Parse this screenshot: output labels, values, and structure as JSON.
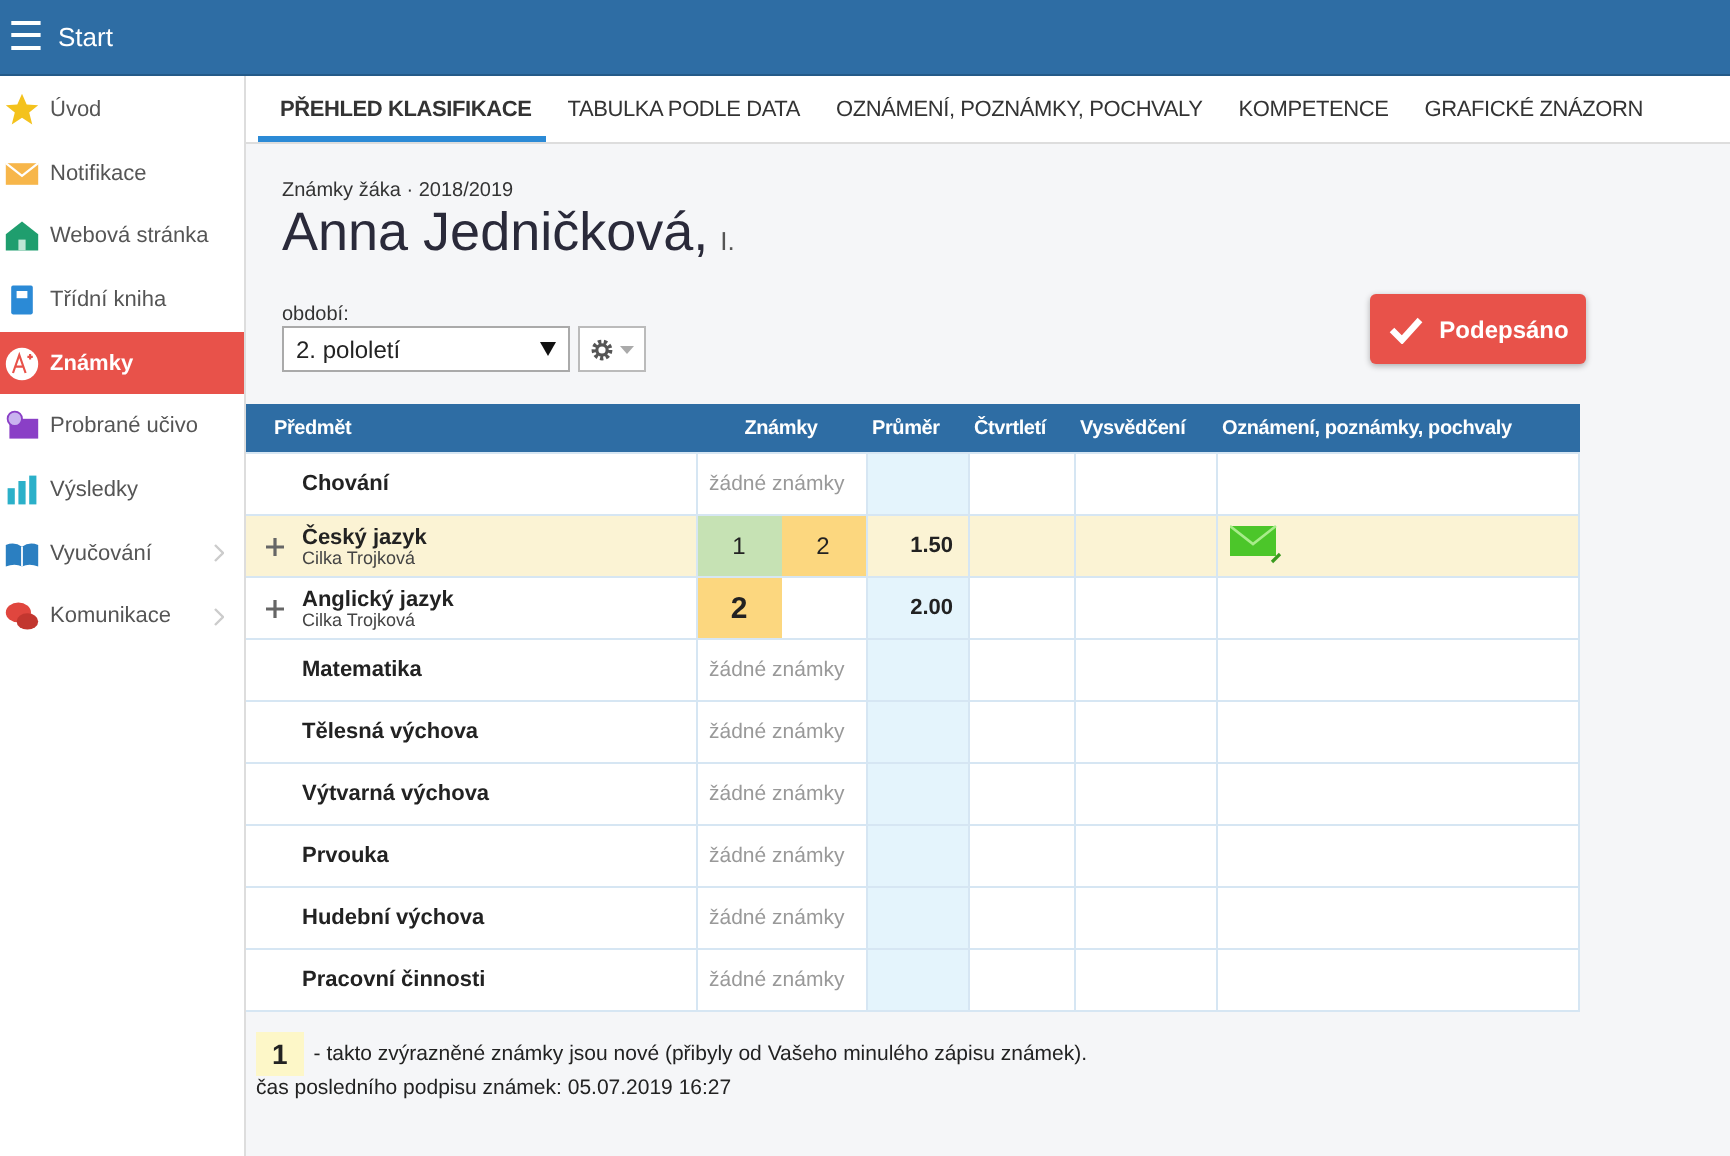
{
  "topbar": {
    "menu_icon": "☰",
    "title": "Start"
  },
  "sidebar": {
    "items": [
      {
        "label": "Úvod",
        "selected": false,
        "has_submenu": false
      },
      {
        "label": "Notifikace",
        "selected": false,
        "has_submenu": false
      },
      {
        "label": "Webová stránka",
        "selected": false,
        "has_submenu": false
      },
      {
        "label": "Třídní kniha",
        "selected": false,
        "has_submenu": false
      },
      {
        "label": "Známky",
        "selected": true,
        "has_submenu": false
      },
      {
        "label": "Probrané učivo",
        "selected": false,
        "has_submenu": false
      },
      {
        "label": "Výsledky",
        "selected": false,
        "has_submenu": false
      },
      {
        "label": "Vyučování",
        "selected": false,
        "has_submenu": true
      },
      {
        "label": "Komunikace",
        "selected": false,
        "has_submenu": true
      }
    ]
  },
  "tabs": [
    {
      "label": "PŘEHLED KLASIFIKACE",
      "selected": true
    },
    {
      "label": "TABULKA PODLE DATA",
      "selected": false
    },
    {
      "label": "OZNÁMENÍ, POZNÁMKY, POCHVALY",
      "selected": false
    },
    {
      "label": "KOMPETENCE",
      "selected": false
    },
    {
      "label": "GRAFICKÉ ZNÁZORN",
      "selected": false
    }
  ],
  "header": {
    "subtitle": "Známky žáka · 2018/2019",
    "student_name": "Anna Jedničková,",
    "class": "I."
  },
  "period": {
    "label": "období:",
    "value": "2. pololetí"
  },
  "signed_button": {
    "label": "Podepsáno"
  },
  "table": {
    "columns": [
      "Předmět",
      "Známky",
      "Průměr",
      "Čtvrtletí",
      "Vysvědčení",
      "Oznámení, poznámky, pochvaly"
    ],
    "rows": [
      {
        "subject": "Chování",
        "expandable": false,
        "highlighted": false,
        "no_grades": "žádné známky",
        "grades": [],
        "has_note": false
      },
      {
        "subject": "Český jazyk",
        "teacher": "Cilka Trojková",
        "expandable": true,
        "highlighted": true,
        "grades": [
          {
            "value": "1",
            "color": "#c6e2b4",
            "new": false
          },
          {
            "value": "2",
            "color": "#fcd77f",
            "new": false
          }
        ],
        "average": "1.50",
        "has_note": true
      },
      {
        "subject": "Anglický jazyk",
        "teacher": "Cilka Trojková",
        "expandable": true,
        "highlighted": false,
        "grades": [
          {
            "value": "2",
            "color": "#fcd77f",
            "new": true
          }
        ],
        "average": "2.00",
        "has_note": false
      },
      {
        "subject": "Matematika",
        "expandable": false,
        "highlighted": false,
        "no_grades": "žádné známky",
        "grades": [],
        "has_note": false
      },
      {
        "subject": "Tělesná výchova",
        "expandable": false,
        "highlighted": false,
        "no_grades": "žádné známky",
        "grades": [],
        "has_note": false
      },
      {
        "subject": "Výtvarná výchova",
        "expandable": false,
        "highlighted": false,
        "no_grades": "žádné známky",
        "grades": [],
        "has_note": false
      },
      {
        "subject": "Prvouka",
        "expandable": false,
        "highlighted": false,
        "no_grades": "žádné známky",
        "grades": [],
        "has_note": false
      },
      {
        "subject": "Hudební výchova",
        "expandable": false,
        "highlighted": false,
        "no_grades": "žádné známky",
        "grades": [],
        "has_note": false
      },
      {
        "subject": "Pracovní činnosti",
        "expandable": false,
        "highlighted": false,
        "no_grades": "žádné známky",
        "grades": [],
        "has_note": false
      }
    ]
  },
  "legend": {
    "sample": "1",
    "text": "- takto zvýrazněné známky jsou nové (přibyly od Vašeho minulého zápisu známek)."
  },
  "last_signature": "čas posledního podpisu známek: 05.07.2019 16:27"
}
